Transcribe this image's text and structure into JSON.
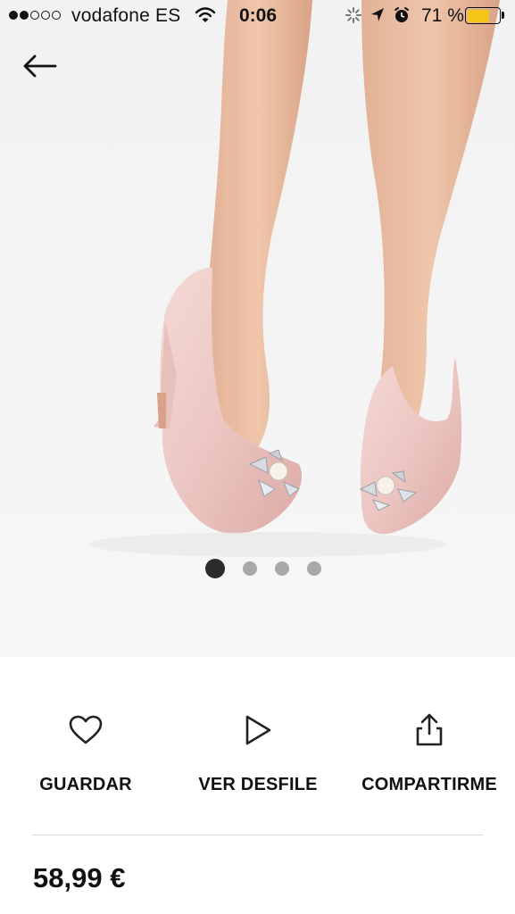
{
  "status_bar": {
    "carrier": "vodafone ES",
    "time": "0:06",
    "battery_percent": "71 %",
    "battery_level": 0.71,
    "signal_bars_filled": 2,
    "signal_bars_total": 5,
    "battery_color": "#f5c518"
  },
  "product": {
    "image_pages": 4,
    "active_page": 1
  },
  "actions": {
    "save_label": "GUARDAR",
    "runway_label": "VER DESFILE",
    "share_label": "COMPARTIRME"
  },
  "price": "58,99 €",
  "icons": {
    "back": "arrow-left-icon",
    "save": "heart-icon",
    "runway": "play-icon",
    "share": "share-icon"
  }
}
